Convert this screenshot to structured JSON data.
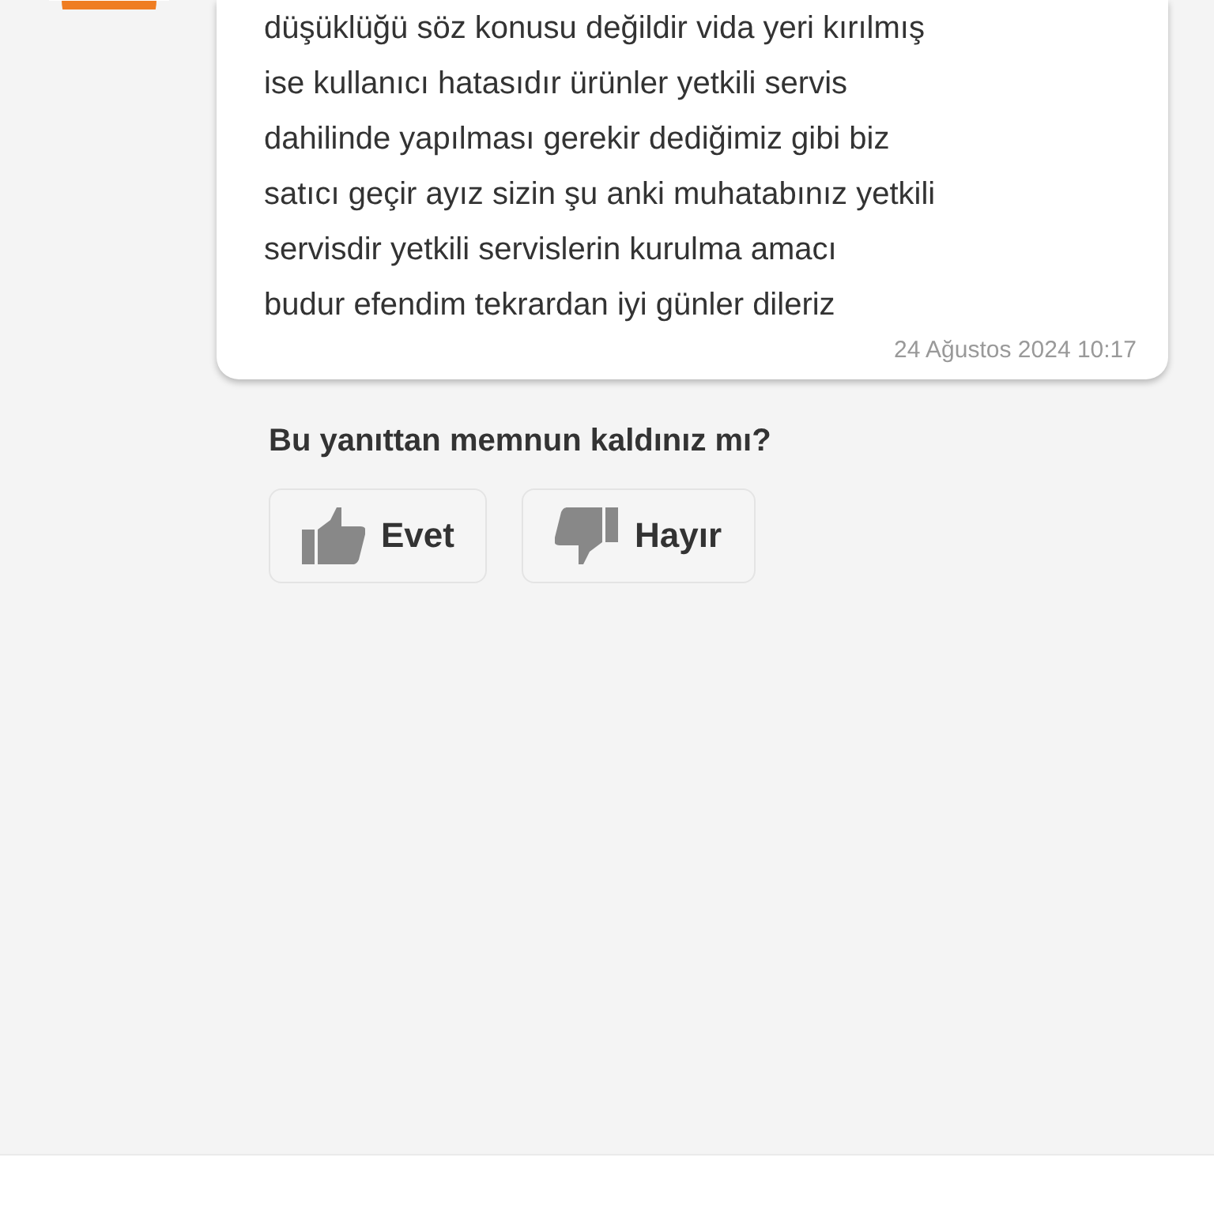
{
  "message": {
    "lines": [
      "düşüklüğü söz konusu değildir vida yeri kırılmış",
      "ise kullanıcı hatasıdır ürünler yetkili servis",
      "dahilinde yapılması gerekir dediğimiz gibi biz",
      "satıcı geçir ayız sizin şu anki muhatabınız yetkili",
      "servisdir yetkili servislerin kurulma amacı",
      "budur efendim tekrardan iyi günler dileriz"
    ],
    "timestamp": "24 Ağustos 2024 10:17"
  },
  "feedback": {
    "question": "Bu yanıttan memnun kaldınız mı?",
    "buttons": [
      {
        "kind": "up",
        "label": "Evet"
      },
      {
        "kind": "down",
        "label": "Hayır"
      }
    ]
  }
}
